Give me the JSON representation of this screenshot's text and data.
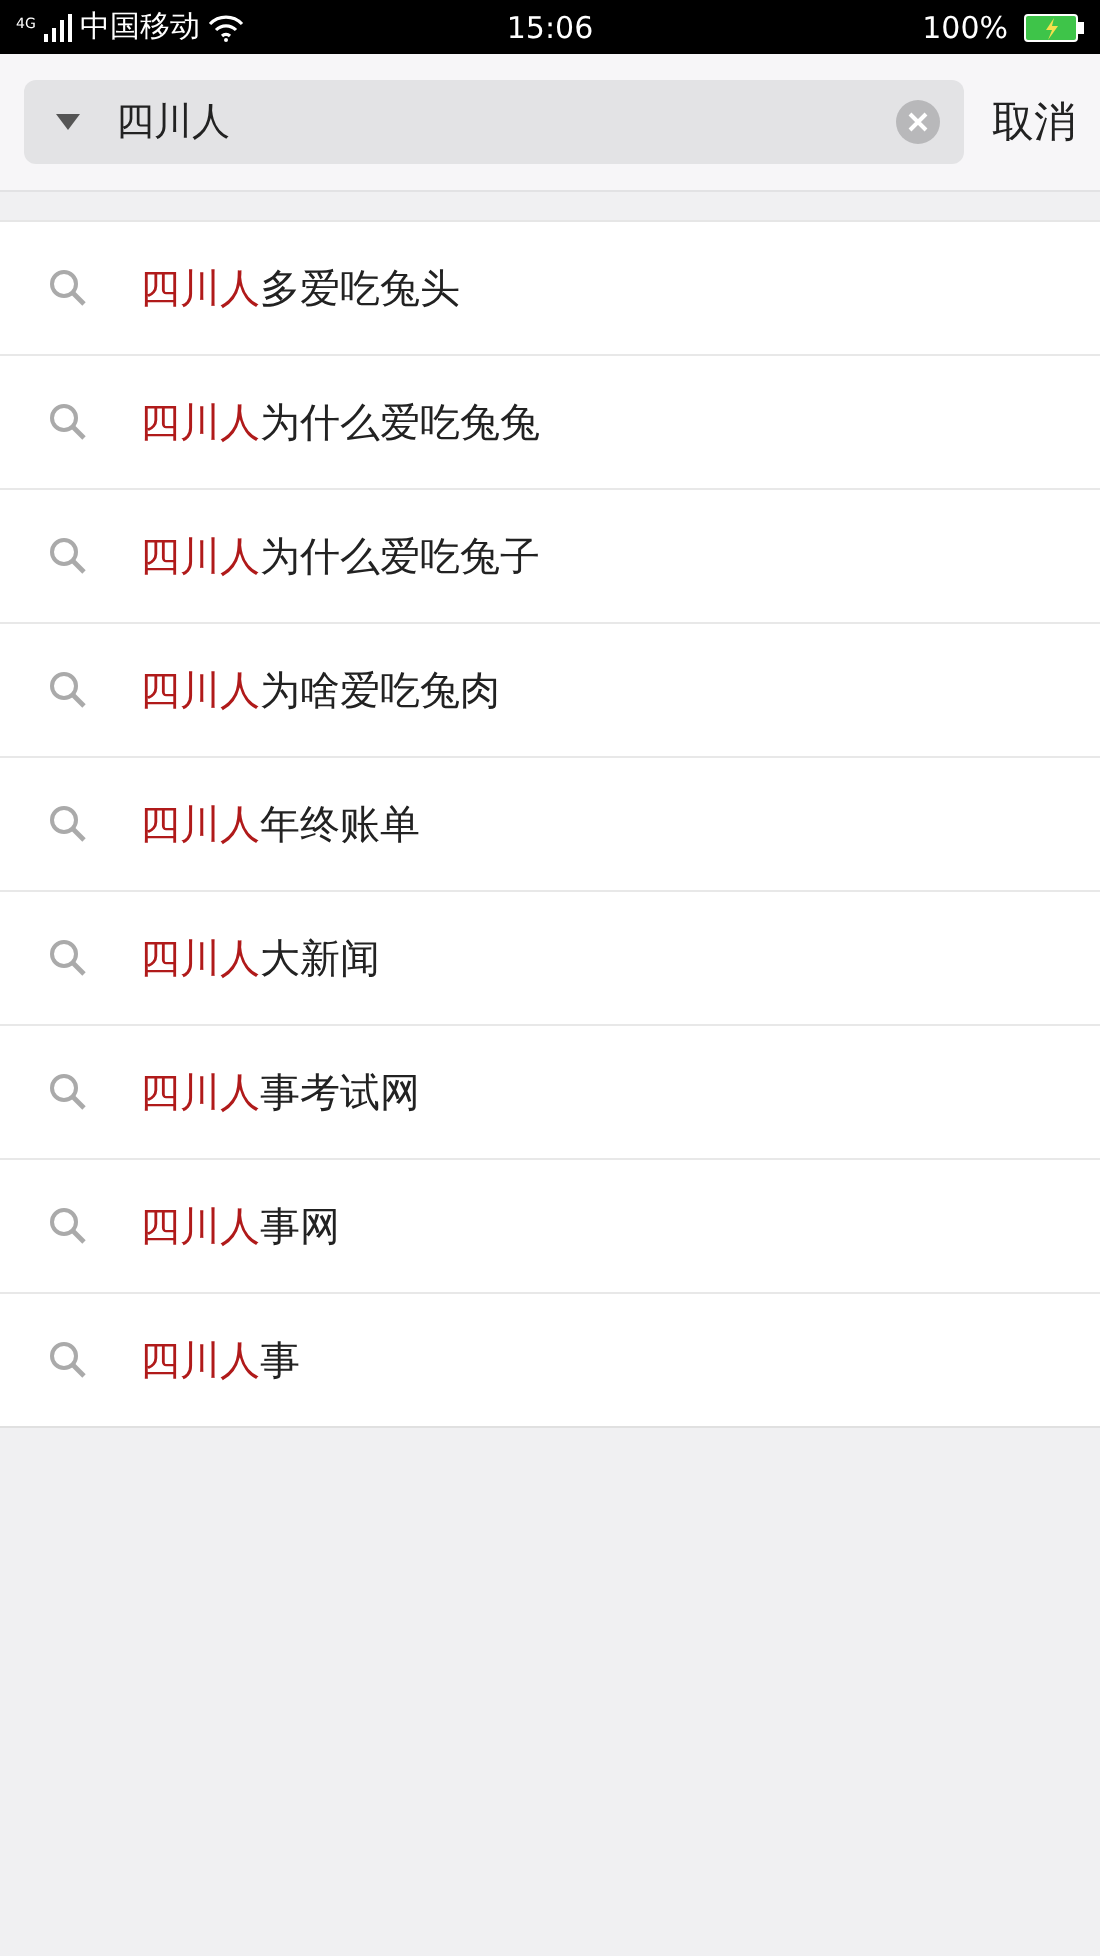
{
  "status_bar": {
    "network": "4G",
    "carrier": "中国移动",
    "time": "15:06",
    "battery": "100%"
  },
  "search": {
    "value": "四川人",
    "cancel": "取消"
  },
  "suggestions": [
    {
      "match": "四川人",
      "rest": "多爱吃兔头"
    },
    {
      "match": "四川人",
      "rest": "为什么爱吃兔兔"
    },
    {
      "match": "四川人",
      "rest": "为什么爱吃兔子"
    },
    {
      "match": "四川人",
      "rest": "为啥爱吃兔肉"
    },
    {
      "match": "四川人",
      "rest": "年终账单"
    },
    {
      "match": "四川人",
      "rest": "大新闻"
    },
    {
      "match": "四川人",
      "rest": "事考试网"
    },
    {
      "match": "四川人",
      "rest": "事网"
    },
    {
      "match": "四川人",
      "rest": "事"
    }
  ]
}
